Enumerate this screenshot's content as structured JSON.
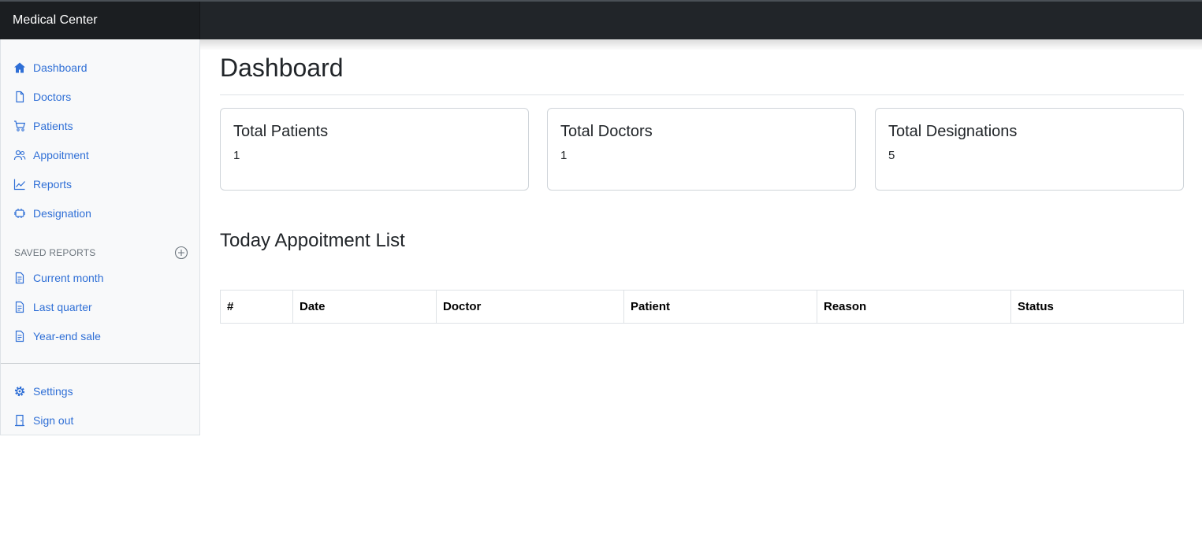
{
  "header": {
    "brand": "Medical Center"
  },
  "sidebar": {
    "items": [
      {
        "label": "Dashboard",
        "icon": "home-icon"
      },
      {
        "label": "Doctors",
        "icon": "file-icon"
      },
      {
        "label": "Patients",
        "icon": "shopping-cart-icon"
      },
      {
        "label": "Appoitment",
        "icon": "users-icon"
      },
      {
        "label": "Reports",
        "icon": "bar-chart-icon"
      },
      {
        "label": "Designation",
        "icon": "layers-icon"
      }
    ],
    "saved_reports_heading": "SAVED REPORTS",
    "saved_reports": [
      {
        "label": "Current month",
        "icon": "file-text-icon"
      },
      {
        "label": "Last quarter",
        "icon": "file-text-icon"
      },
      {
        "label": "Year-end sale",
        "icon": "file-text-icon"
      }
    ],
    "bottom": [
      {
        "label": "Settings",
        "icon": "gear-icon"
      },
      {
        "label": "Sign out",
        "icon": "door-icon"
      }
    ]
  },
  "main": {
    "title": "Dashboard",
    "cards": [
      {
        "title": "Total Patients",
        "value": "1"
      },
      {
        "title": "Total Doctors",
        "value": "1"
      },
      {
        "title": "Total Designations",
        "value": "5"
      }
    ],
    "section_title": "Today Appoitment List",
    "table": {
      "columns": [
        "#",
        "Date",
        "Doctor",
        "Patient",
        "Reason",
        "Status"
      ],
      "rows": []
    }
  },
  "colors": {
    "link": "#2f6fd6",
    "topbar": "#212529",
    "sidebar_bg": "#f8f9fa"
  }
}
